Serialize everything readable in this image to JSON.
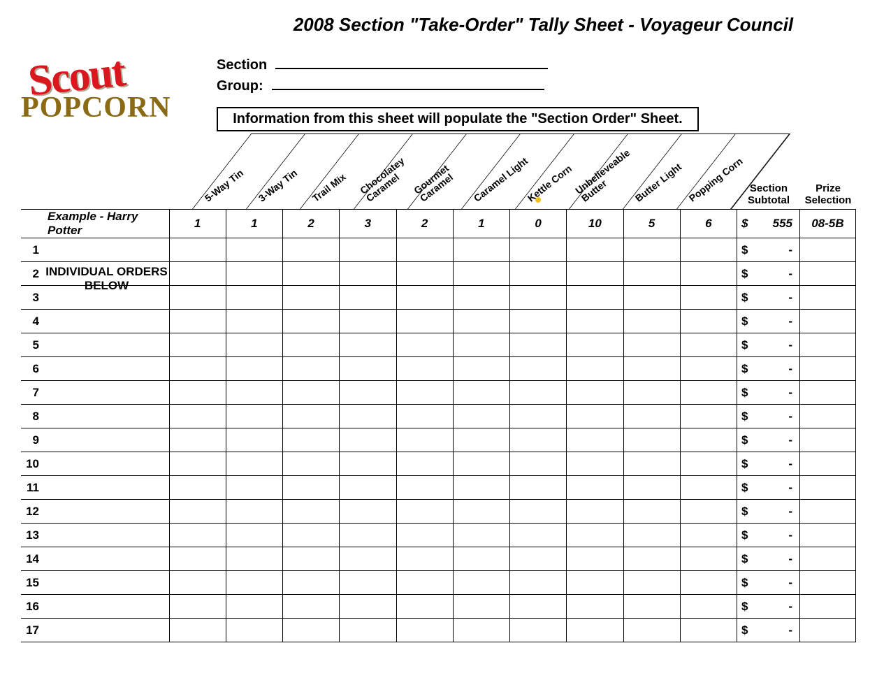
{
  "title": "2008 Section  \"Take-Order\" Tally Sheet - Voyageur Council",
  "logo": {
    "line1": "Scout",
    "line2": "POPCORN"
  },
  "fields": {
    "section_label": "Section",
    "group_label": "Group:"
  },
  "info_banner": "Information from this sheet will populate the \"Section Order\" Sheet.",
  "individual_label": "INDIVIDUAL ORDERS\nBELOW",
  "products": [
    "5-Way Tin",
    "3-Way Tin",
    "Trail Mix",
    "Chocolatey\nCaramel",
    "Gourmet\nCaramel",
    "Caramel Light",
    "Kettle Corn",
    "Unbelieveable\nButter",
    "Butter Light",
    "Popping Corn"
  ],
  "right_headers": {
    "subtotal": "Section\nSubtotal",
    "prize": "Prize\nSelection"
  },
  "currency": "$",
  "dash": "-",
  "example": {
    "name": "Example - Harry Potter",
    "values": [
      "1",
      "1",
      "2",
      "3",
      "2",
      "1",
      "0",
      "10",
      "5",
      "6"
    ],
    "subtotal": "555",
    "prize": "08-5B"
  },
  "rows": [
    "1",
    "2",
    "3",
    "4",
    "5",
    "6",
    "7",
    "8",
    "9",
    "10",
    "11",
    "12",
    "13",
    "14",
    "15",
    "16",
    "17"
  ]
}
